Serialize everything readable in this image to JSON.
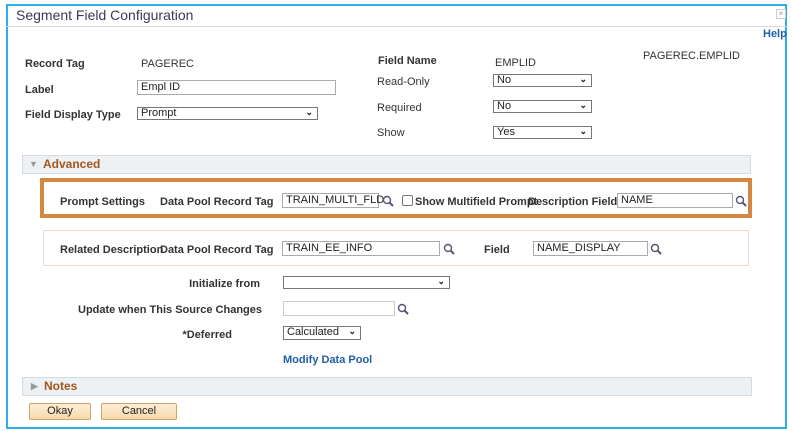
{
  "window": {
    "title": "Segment Field Configuration",
    "close": "×",
    "help": "Help"
  },
  "form": {
    "record_tag_label": "Record Tag",
    "record_tag": "PAGEREC",
    "label_label": "Label",
    "label_value": "Empl ID",
    "display_type_label": "Field Display Type",
    "display_type": "Prompt",
    "field_name_label": "Field Name",
    "field_name": "EMPLID",
    "full_name": "PAGEREC.EMPLID",
    "read_only_label": "Read-Only",
    "read_only": "No",
    "required_label": "Required",
    "required": "No",
    "show_label": "Show",
    "show": "Yes"
  },
  "advanced": {
    "title": "Advanced",
    "prompt": {
      "section": "Prompt Settings",
      "pool_tag_label": "Data Pool Record Tag",
      "pool_tag": "TRAIN_MULTI_FLD",
      "multifield_label": "Show Multifield Prompt",
      "multifield_checked": false,
      "desc_field_label": "Description Field",
      "desc_field": "NAME"
    },
    "related": {
      "section": "Related Description",
      "pool_tag_label": "Data Pool Record Tag",
      "pool_tag": "TRAIN_EE_INFO",
      "field_label": "Field",
      "field": "NAME_DISPLAY"
    },
    "initialize_label": "Initialize from",
    "initialize": "",
    "update_label": "Update when This Source Changes",
    "update": "",
    "deferred_label": "*Deferred",
    "deferred": "Calculated",
    "modify_link": "Modify Data Pool"
  },
  "notes": {
    "title": "Notes"
  },
  "buttons": {
    "okay": "Okay",
    "cancel": "Cancel"
  },
  "colors": {
    "highlight": "#d4873f",
    "border": "#2bb0e6",
    "section_title": "#a5561a"
  }
}
